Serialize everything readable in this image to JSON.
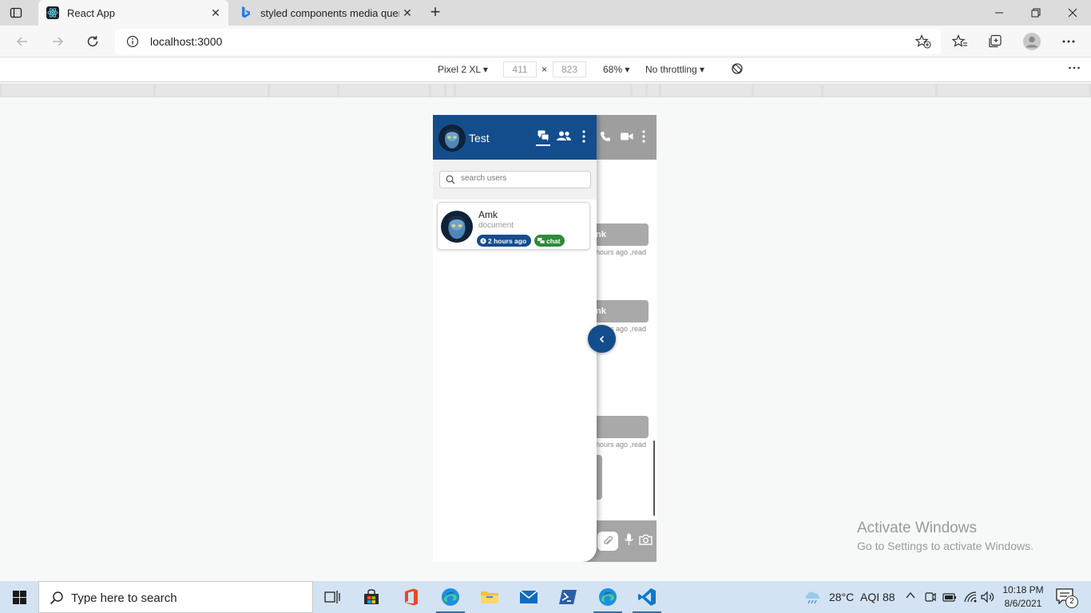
{
  "browser": {
    "tabs": [
      {
        "title": "React App",
        "active": true
      },
      {
        "title": "styled components media querie",
        "active": false
      }
    ],
    "address": "localhost:3000"
  },
  "devtools": {
    "device": "Pixel 2 XL",
    "width": "411",
    "times": "×",
    "height": "823",
    "zoom": "68%",
    "throttling": "No throttling"
  },
  "app": {
    "header_title": "Test",
    "search_placeholder": "search users",
    "users": [
      {
        "name": "Amk",
        "preview": "document",
        "time": "2 hours ago",
        "type": "chat"
      }
    ],
    "chat_behind": {
      "messages": [
        {
          "name": "nk",
          "meta": "hours ago ,read"
        },
        {
          "name": "nk",
          "meta": "hours ago ,read"
        },
        {
          "name": "",
          "meta": "hours ago ,read"
        }
      ]
    }
  },
  "watermark": {
    "line1": "Activate Windows",
    "line2": "Go to Settings to activate Windows."
  },
  "taskbar": {
    "search_placeholder": "Type here to search",
    "weather": "28°C",
    "aqi": "AQI 88",
    "time": "10:18 PM",
    "date": "8/6/2021",
    "notifications": "2"
  },
  "colors": {
    "app_primary": "#144d8c",
    "badge_green": "#2e8b3a",
    "taskbar": "#d3e3f3"
  }
}
